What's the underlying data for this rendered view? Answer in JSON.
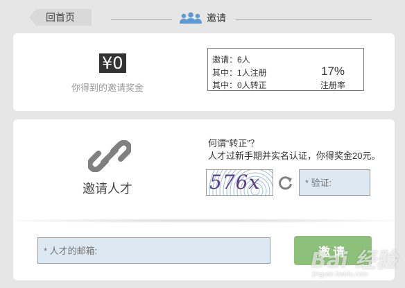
{
  "header": {
    "back_label": "回首页",
    "title": "邀请"
  },
  "reward": {
    "amount": "¥0",
    "label": "你得到的邀请奖金"
  },
  "stats": {
    "invited": "邀请：6人",
    "registered": "其中：1人注册",
    "converted": "其中：0人转正",
    "rate_value": "17%",
    "rate_label": "注册率"
  },
  "invite": {
    "title": "邀请人才",
    "question": "何谓“转正”？",
    "description": "人才过新手期并实名认证，你得奖金20元。",
    "captcha_text": "576x",
    "verify_placeholder": "* 验证:",
    "email_placeholder": "* 人才的邮箱:",
    "submit_label": "邀请"
  },
  "watermark": {
    "logo": "Bai 经验",
    "url": "jingyan.baidu.com"
  },
  "colors": {
    "accent_green": "#8dc07a",
    "input_bg": "#dce8f2",
    "icon_blue": "#5b9bd5",
    "icon_gray": "#808080"
  }
}
